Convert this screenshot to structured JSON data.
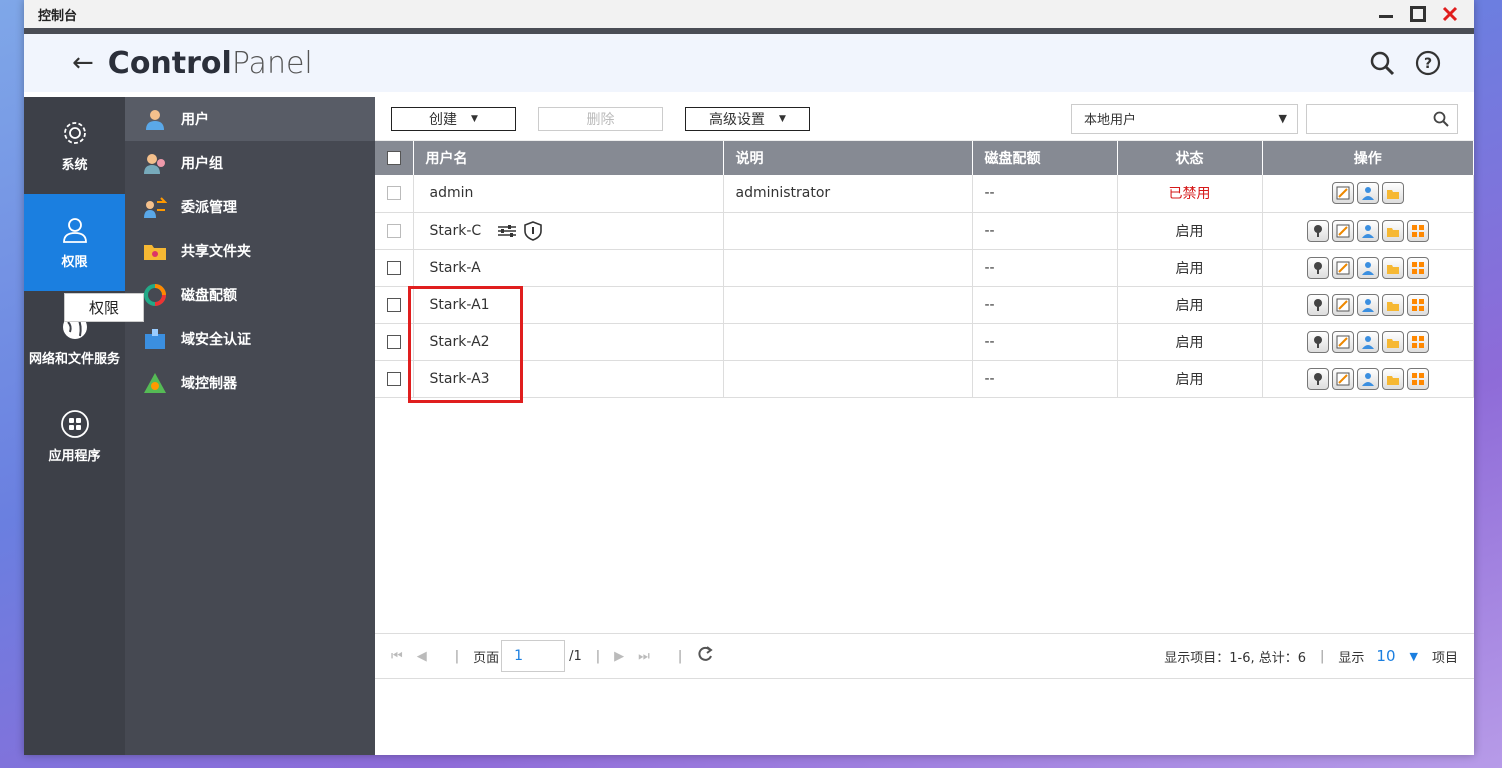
{
  "window": {
    "title": "控制台"
  },
  "header": {
    "brand_bold": "Control",
    "brand_light": "Panel"
  },
  "rail": [
    {
      "label": "系统",
      "icon": "gear-icon"
    },
    {
      "label": "权限",
      "icon": "user-icon"
    },
    {
      "label": "网络和文件服务",
      "icon": "globe-icon"
    },
    {
      "label": "应用程序",
      "icon": "apps-icon"
    }
  ],
  "tooltip": "权限",
  "submenu": [
    {
      "label": "用户",
      "icon": "user-avatar-icon"
    },
    {
      "label": "用户组",
      "icon": "user-group-icon"
    },
    {
      "label": "委派管理",
      "icon": "delegate-icon"
    },
    {
      "label": "共享文件夹",
      "icon": "shared-folder-icon"
    },
    {
      "label": "磁盘配额",
      "icon": "disk-quota-icon"
    },
    {
      "label": "域安全认证",
      "icon": "domain-security-icon"
    },
    {
      "label": "域控制器",
      "icon": "domain-controller-icon"
    }
  ],
  "toolbar": {
    "create": "创建",
    "delete": "删除",
    "advanced": "高级设置",
    "filter": "本地用户"
  },
  "table": {
    "headers": [
      "用户名",
      "说明",
      "磁盘配额",
      "状态",
      "操作"
    ],
    "rows": [
      {
        "name": "admin",
        "desc": "administrator",
        "quota": "--",
        "status": "已禁用"
      },
      {
        "name": "Stark-C",
        "desc": "",
        "quota": "--",
        "status": "启用"
      },
      {
        "name": "Stark-A",
        "desc": "",
        "quota": "--",
        "status": "启用"
      },
      {
        "name": "Stark-A1",
        "desc": "",
        "quota": "--",
        "status": "启用"
      },
      {
        "name": "Stark-A2",
        "desc": "",
        "quota": "--",
        "status": "启用"
      },
      {
        "name": "Stark-A3",
        "desc": "",
        "quota": "--",
        "status": "启用"
      }
    ]
  },
  "pager": {
    "page_label": "页面",
    "page": "1",
    "total_pages": "/1",
    "summary": "显示项目：1-6, 总计：6",
    "show": "显示",
    "per_page": "10",
    "items": "项目"
  },
  "colors": {
    "accent": "#1b7fe0",
    "disabled_status": "#d61a1a",
    "highlight_box": "#e01e1e"
  }
}
